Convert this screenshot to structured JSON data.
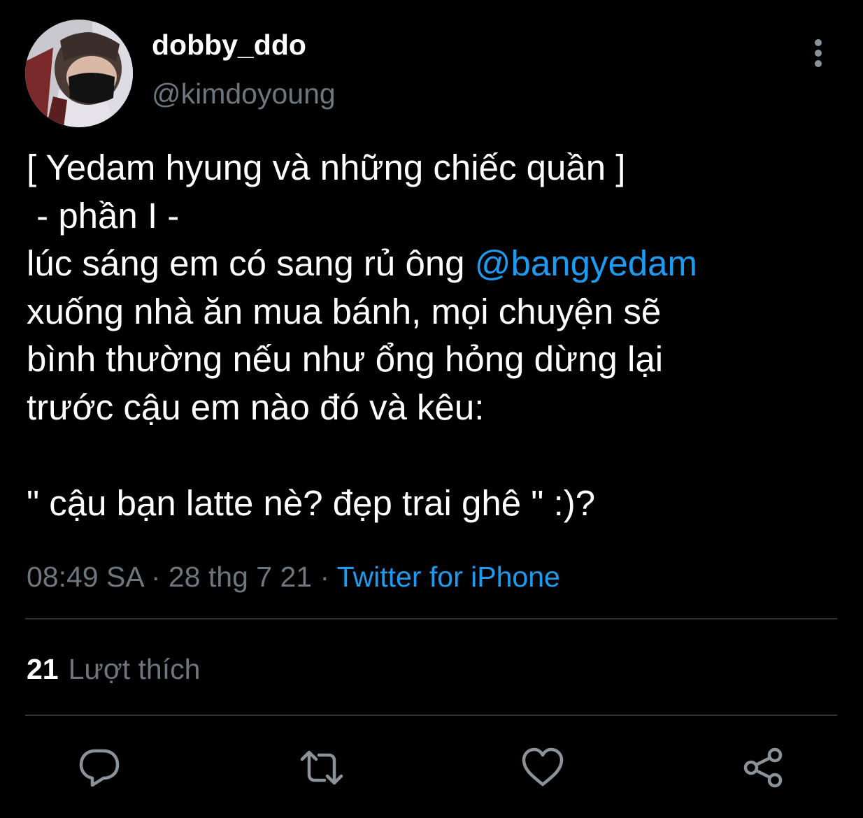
{
  "tweet": {
    "display_name": "dobby_ddo",
    "handle": "@kimdoyoung",
    "text": {
      "line1": "[ Yedam hyung và những chiếc quần ]",
      "line2": " - phần I -",
      "line3_before_mention": "lúc sáng em có sang rủ ông ",
      "mention": "@bangyedam",
      "line4": "xuống nhà ăn mua bánh, mọi chuyện sẽ",
      "line5": "bình thường nếu như ổng hỏng dừng lại",
      "line6": "trước cậu em nào đó và kêu:",
      "line8": "\" cậu bạn latte nè? đẹp trai ghê \" :)?"
    },
    "time": "08:49 SA",
    "separator": " · ",
    "date": "28 thg 7 21",
    "source": "Twitter for iPhone",
    "likes_count": "21",
    "likes_label": "Lượt thích"
  },
  "colors": {
    "background": "#000000",
    "text_primary": "#ffffff",
    "text_secondary": "#6e767d",
    "accent": "#1d9bf0",
    "divider": "#2f3336"
  },
  "icons": {
    "more": "more-vertical-icon",
    "reply": "comment-icon",
    "retweet": "retweet-icon",
    "like": "heart-icon",
    "share": "share-icon"
  }
}
